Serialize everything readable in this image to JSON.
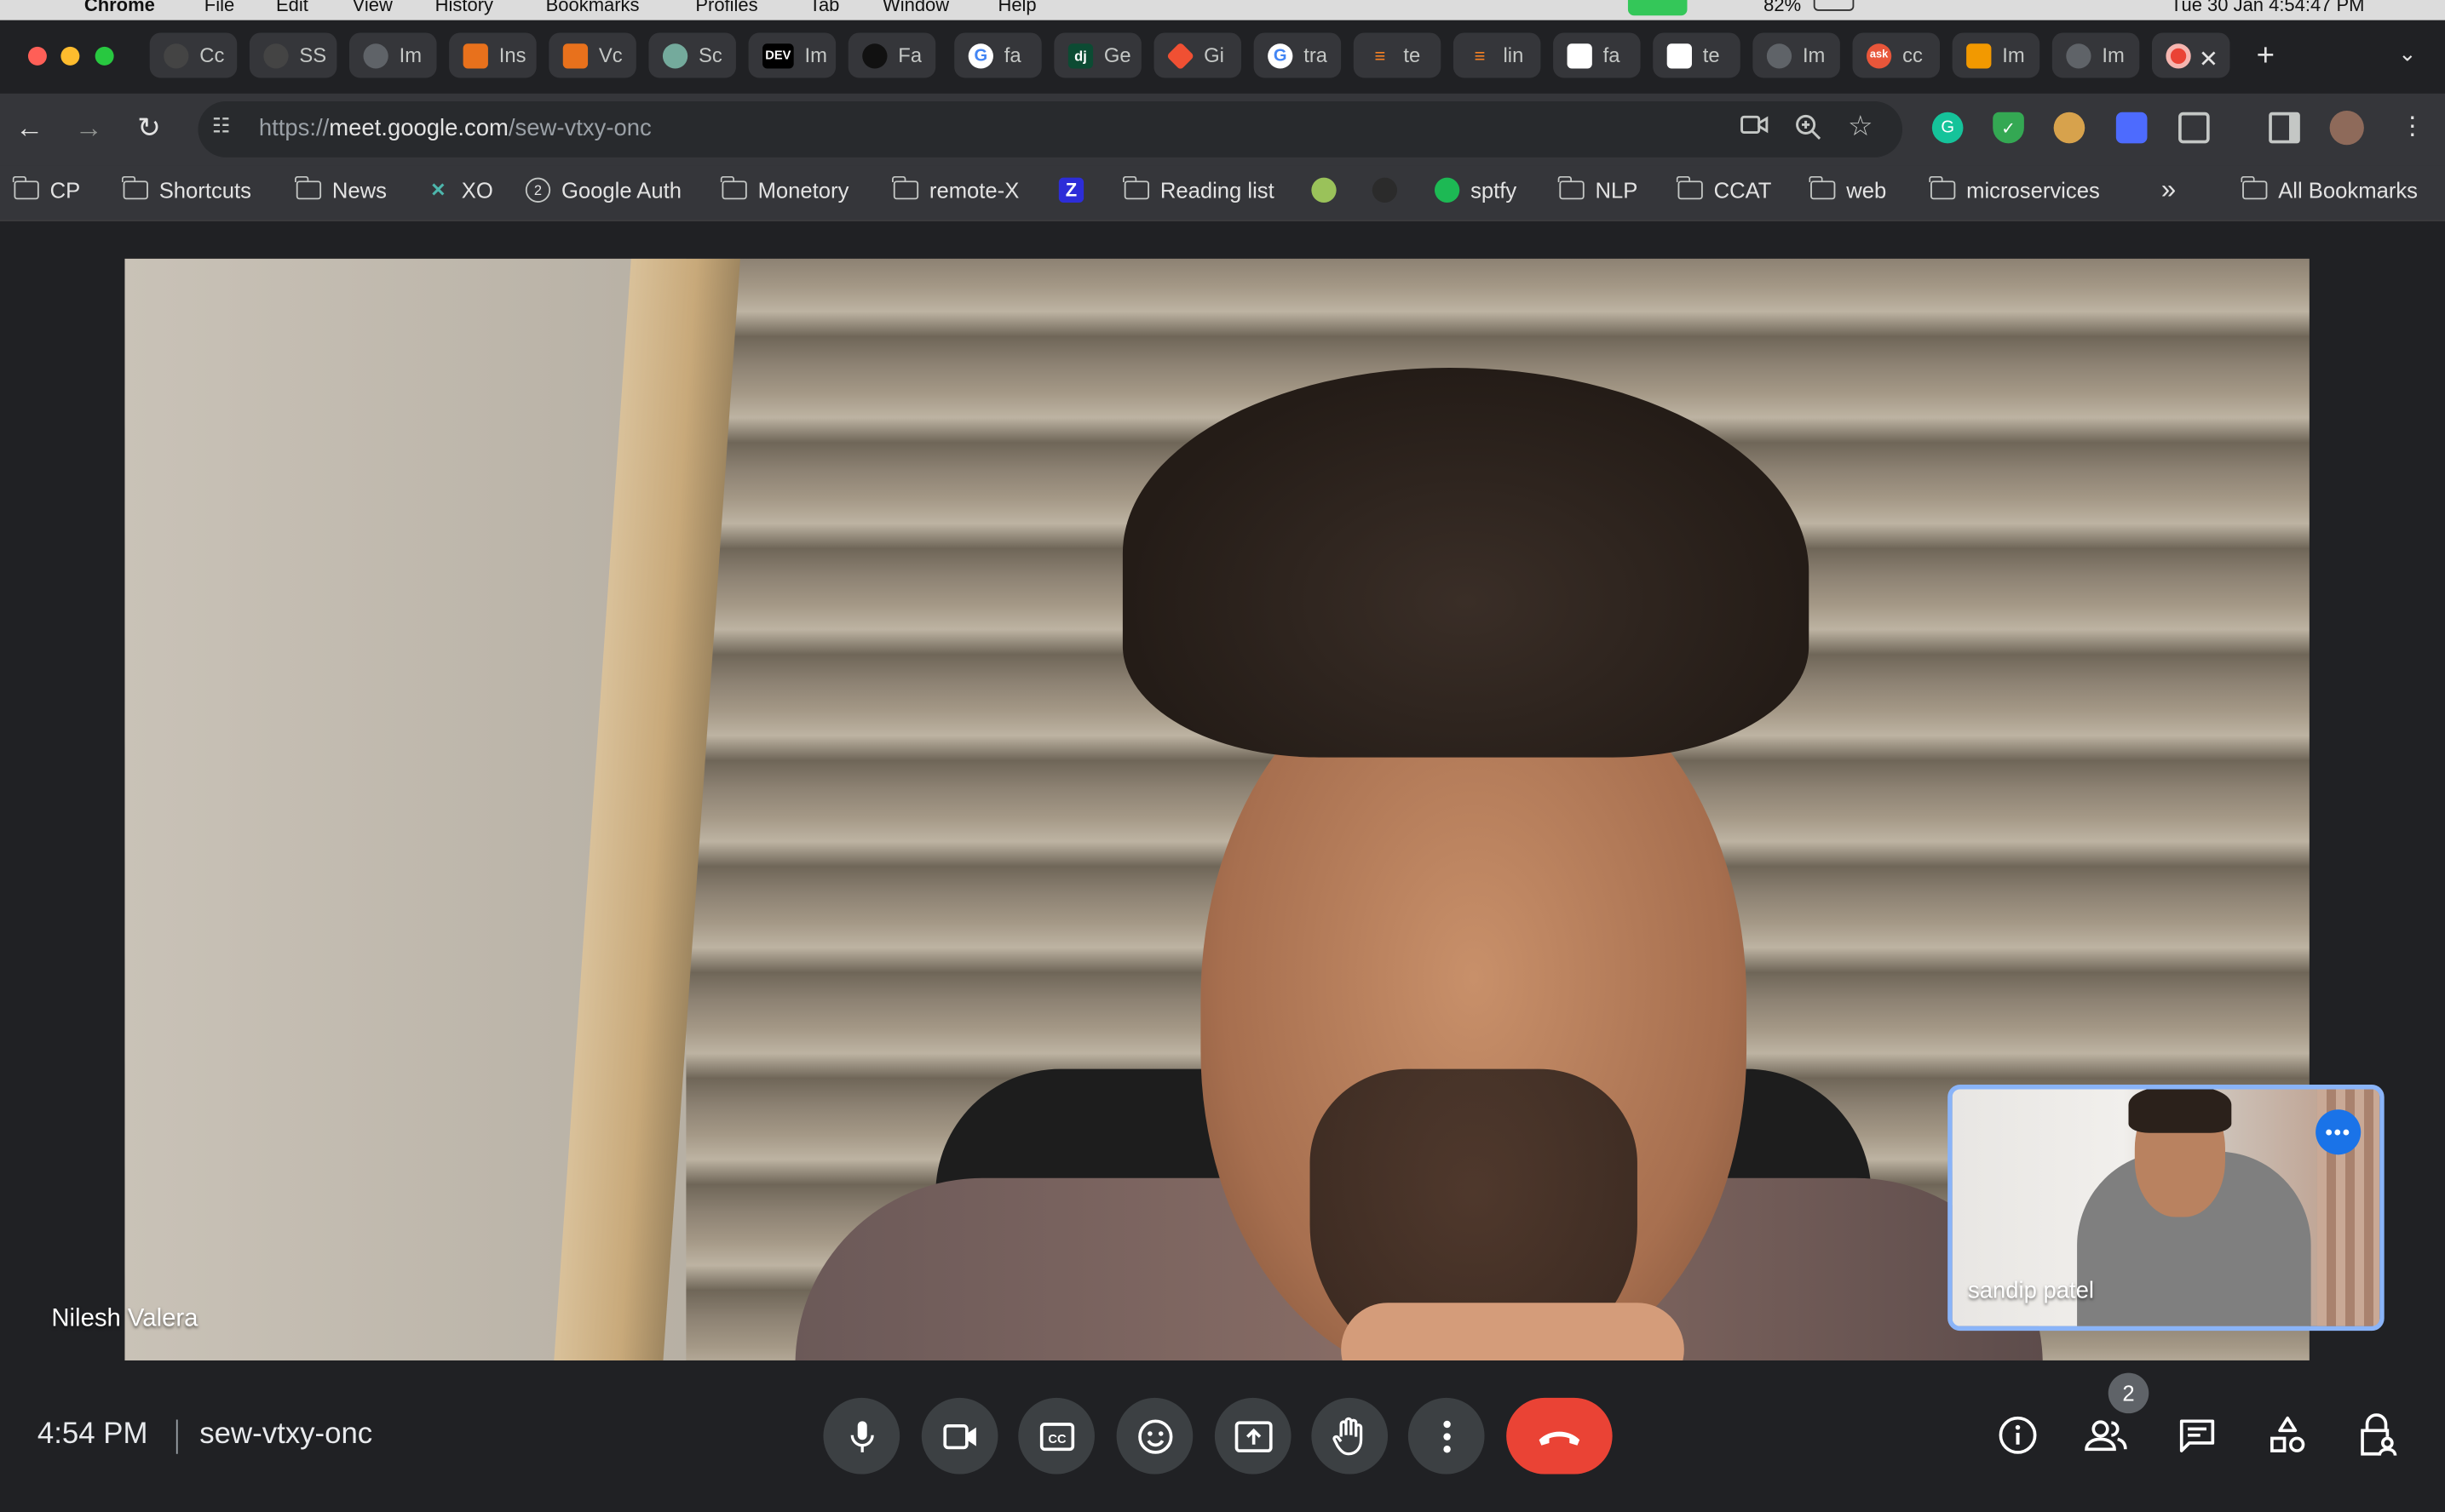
{
  "mac_menu": {
    "app": "Chrome",
    "items": [
      "File",
      "Edit",
      "View",
      "History",
      "Bookmarks",
      "Profiles",
      "Tab",
      "Window",
      "Help"
    ],
    "battery": "82%",
    "datetime": "Tue 30 Jan  4:54:47 PM"
  },
  "tabs": [
    {
      "label": "Cc",
      "icon": "github-icon"
    },
    {
      "label": "SS",
      "icon": "github-icon"
    },
    {
      "label": "Im",
      "icon": "globe-icon"
    },
    {
      "label": "Ins",
      "icon": "orange-extension-icon"
    },
    {
      "label": "Vc",
      "icon": "orange-extension-icon"
    },
    {
      "label": "Sc",
      "icon": "chatgpt-icon"
    },
    {
      "label": "Im",
      "icon": "dev-icon"
    },
    {
      "label": "Fa",
      "icon": "dark-circle-icon"
    },
    {
      "label": "fa",
      "icon": "google-icon"
    },
    {
      "label": "Ge",
      "icon": "django-icon"
    },
    {
      "label": "Gi",
      "icon": "git-icon"
    },
    {
      "label": "tra",
      "icon": "google-icon"
    },
    {
      "label": "te",
      "icon": "stackoverflow-icon"
    },
    {
      "label": "lin",
      "icon": "stackoverflow-icon"
    },
    {
      "label": "fa",
      "icon": "cube-icon"
    },
    {
      "label": "te",
      "icon": "cube-icon"
    },
    {
      "label": "Im",
      "icon": "globe-icon"
    },
    {
      "label": "cc",
      "icon": "ask-icon"
    },
    {
      "label": "Im",
      "icon": "orange-book-icon"
    },
    {
      "label": "Im",
      "icon": "globe-icon"
    }
  ],
  "active_tab_close": "✕",
  "address_bar": {
    "scheme": "https://",
    "host": "meet.google.com",
    "path": "/sew-vtxy-onc"
  },
  "bookmarks": [
    {
      "label": "CP",
      "icon": "folder-icon"
    },
    {
      "label": "Shortcuts",
      "icon": "folder-icon"
    },
    {
      "label": "News",
      "icon": "folder-icon"
    },
    {
      "label": "XO",
      "icon": "xo-icon"
    },
    {
      "label": "Google Auth",
      "icon": "google-auth-icon"
    },
    {
      "label": "Monetory",
      "icon": "folder-icon"
    },
    {
      "label": "remote-X",
      "icon": "folder-icon"
    },
    {
      "label": "",
      "icon": "z-icon"
    },
    {
      "label": "Reading list",
      "icon": "folder-icon"
    },
    {
      "label": "",
      "icon": "android-icon"
    },
    {
      "label": "",
      "icon": "github-icon"
    },
    {
      "label": "sptfy",
      "icon": "spotify-icon"
    },
    {
      "label": "NLP",
      "icon": "folder-icon"
    },
    {
      "label": "CCAT",
      "icon": "folder-icon"
    },
    {
      "label": "web",
      "icon": "folder-icon"
    },
    {
      "label": "microservices",
      "icon": "folder-icon"
    }
  ],
  "bookmarks_overflow": "»",
  "all_bookmarks": "All Bookmarks",
  "meeting": {
    "main_participant": "Nilesh Valera",
    "self_participant": "sandip patel",
    "time": "4:54 PM",
    "code": "sew-vtxy-onc",
    "participant_count": "2"
  },
  "colors": {
    "end_call": "#ea4335",
    "pip_border": "#8ab4f8",
    "pip_menu": "#1a73e8",
    "control_bg": "#3c4043"
  }
}
